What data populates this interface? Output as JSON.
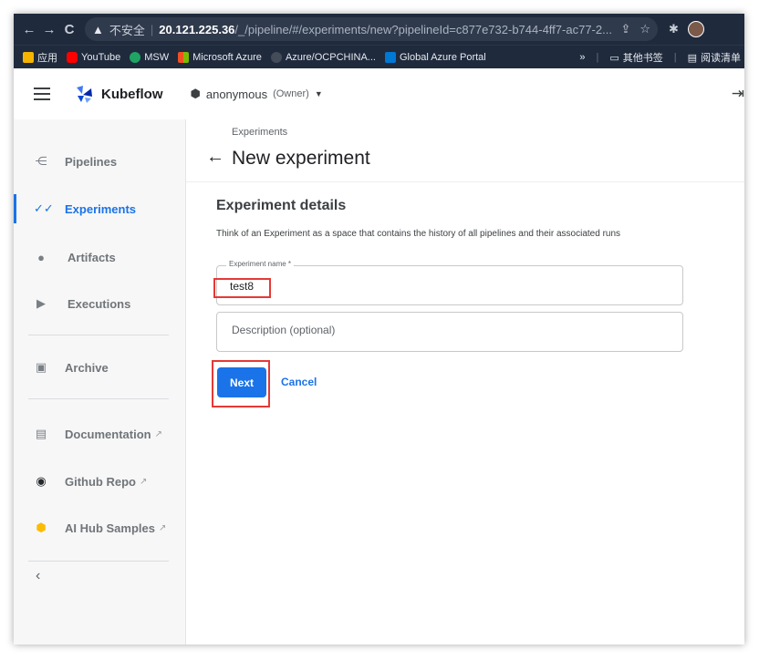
{
  "browser": {
    "back_icon": "←",
    "forward_icon": "→",
    "reload_icon": "C",
    "warning_icon": "▲",
    "insecure_label": "不安全",
    "url_host": "20.121.225.36",
    "url_path": "/_/pipeline/#/experiments/new?pipelineId=c877e732-b744-4ff7-ac77-2...",
    "bookmarks": [
      {
        "label": "应用",
        "icon_color": "#f4b400"
      },
      {
        "label": "YouTube",
        "icon_color": "#ff0000"
      },
      {
        "label": "MSW",
        "icon_color": "#1fa463"
      },
      {
        "label": "Microsoft Azure",
        "icon_color": "#f25022"
      },
      {
        "label": "Azure/OCPCHINA...",
        "icon_color": "#444b59"
      },
      {
        "label": "Global Azure Portal",
        "icon_color": "#0078d4"
      }
    ],
    "more_bookmarks_label": "»",
    "other_bookmarks_label": "其他书签",
    "reading_list_label": "阅读清单"
  },
  "app": {
    "brand": "Kubeflow",
    "namespace": "anonymous",
    "namespace_role": "(Owner)",
    "accent_color": "#1a73e8"
  },
  "sidebar": {
    "items": [
      {
        "label": "Pipelines"
      },
      {
        "label": "Experiments"
      },
      {
        "label": "Artifacts"
      },
      {
        "label": "Executions"
      },
      {
        "label": "Archive"
      },
      {
        "label": "Documentation"
      },
      {
        "label": "Github Repo"
      },
      {
        "label": "AI Hub Samples"
      }
    ],
    "active": "Experiments",
    "collapse_icon": "‹"
  },
  "page": {
    "breadcrumb": "Experiments",
    "title": "New experiment",
    "section_title": "Experiment details",
    "description": "Think of an Experiment as a space that contains the history of all pipelines and their associated runs",
    "name_label": "Experiment name *",
    "name_value": "test8",
    "description_placeholder": "Description (optional)",
    "next_label": "Next",
    "cancel_label": "Cancel"
  }
}
